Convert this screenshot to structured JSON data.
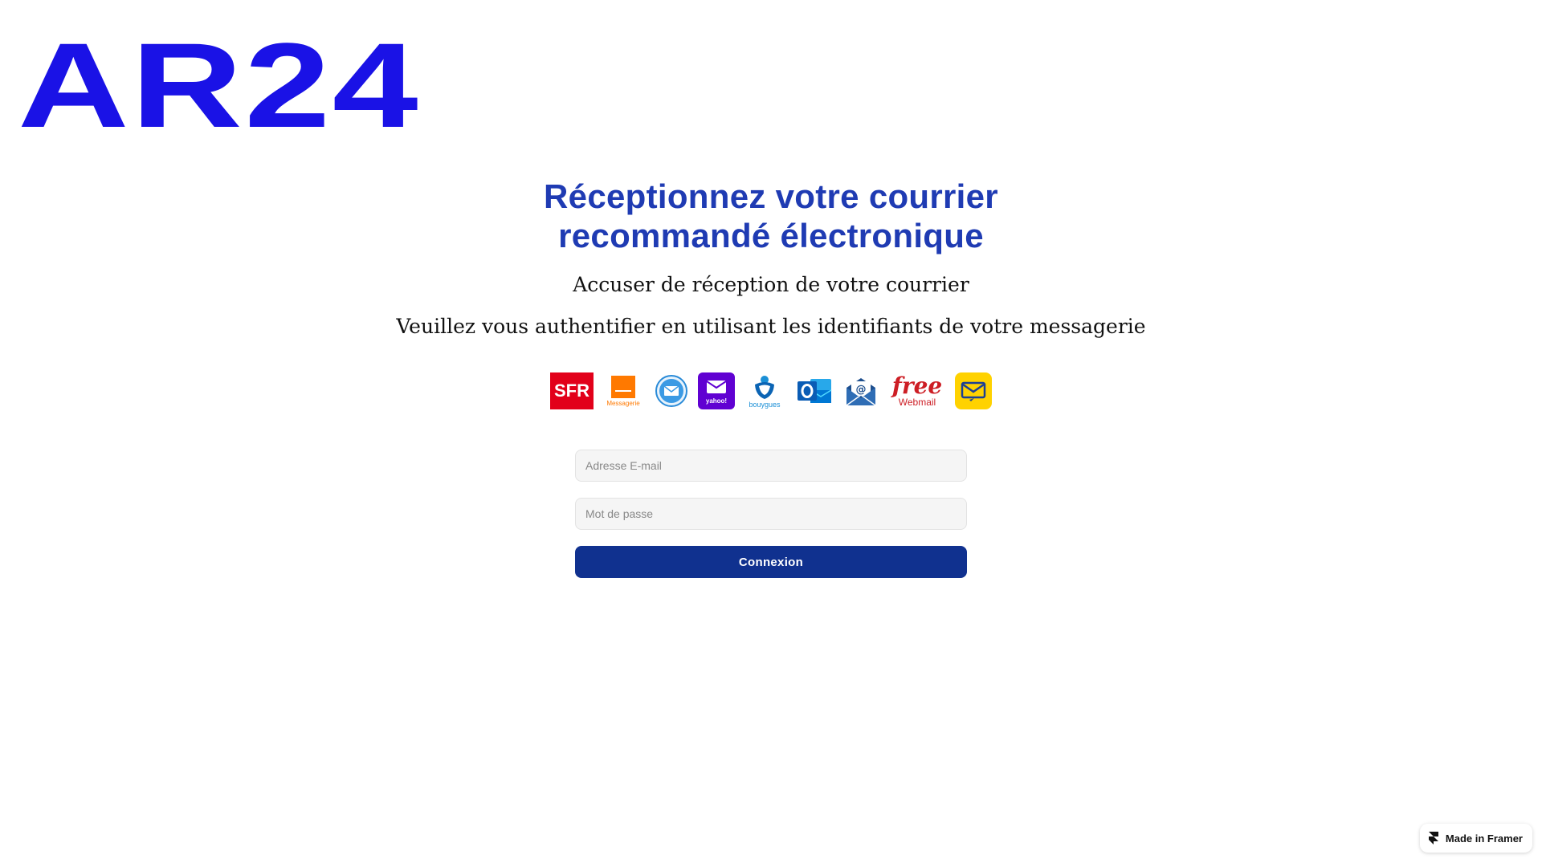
{
  "logo": {
    "text": "AR24",
    "color": "#1a12e6"
  },
  "main": {
    "title_line1": "Réceptionnez votre courrier",
    "title_line2": "recommandé électronique",
    "subtitle": "Accuser de réception de votre courrier",
    "instruction": "Veuillez vous authentifier en utilisant les identifiants de votre messagerie"
  },
  "providers": {
    "sfr": "SFR",
    "orange": "Messagerie",
    "yahoo": "yahoo!",
    "bouygues": "bouygues",
    "free_line1": "free",
    "free_line2": "Webmail"
  },
  "form": {
    "email_placeholder": "Adresse E-mail",
    "email_value": "",
    "password_placeholder": "Mot de passe",
    "password_value": "",
    "submit_label": "Connexion"
  },
  "badge": {
    "label": "Made in Framer"
  },
  "colors": {
    "title": "#1f3bb3",
    "button": "#10318f",
    "input_bg": "#f5f5f5"
  }
}
